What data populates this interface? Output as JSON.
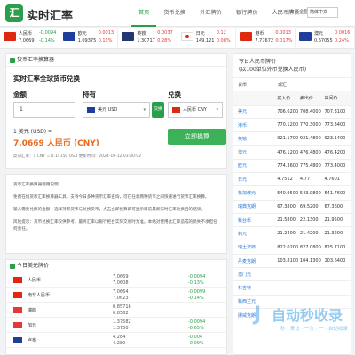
{
  "app": {
    "logo_char": "汇",
    "name": "实时汇率"
  },
  "nav": [
    {
      "label": "首页",
      "active": true
    },
    {
      "label": "货币兑换"
    },
    {
      "label": "外汇牌价"
    },
    {
      "label": "银行牌价"
    },
    {
      "label": "人民币牌价"
    },
    {
      "label": "货币代码"
    }
  ],
  "lang": {
    "label": "大写金额",
    "selected": "简体中文"
  },
  "ticker": [
    {
      "name": "人民币",
      "rate": "7.0669",
      "chg": "-0.0094",
      "pct": "-0.14%",
      "dir": "down",
      "flag": "#de2910"
    },
    {
      "name": "欧元",
      "rate": "1.09375",
      "chg": "0.0013",
      "pct": "0.12%",
      "dir": "up",
      "flag": "#1f3e9c"
    },
    {
      "name": "英镑",
      "rate": "1.30717",
      "chg": "0.0037",
      "pct": "0.28%",
      "dir": "up",
      "flag": "#23366f"
    },
    {
      "name": "日元",
      "rate": "149.121",
      "chg": "0.12",
      "pct": "0.08%",
      "dir": "up",
      "flag": "#ffffff"
    },
    {
      "name": "港币",
      "rate": "7.77672",
      "chg": "0.0013",
      "pct": "0.017%",
      "dir": "up",
      "flag": "#de2910"
    },
    {
      "name": "澳元",
      "rate": "0.67055",
      "chg": "0.0016",
      "pct": "0.24%",
      "dir": "up",
      "flag": "#1f3e9c"
    }
  ],
  "converter": {
    "panel_title": "货币汇率换算器",
    "title": "实时汇率全球货币兑换",
    "amount_label": "金额",
    "amount_value": "1",
    "from_label": "持有",
    "from_value": "美元 USD",
    "swap_label": "交换",
    "to_label": "兑换",
    "to_value": "人民币 CNY",
    "one_line": "1 美元 (USD) =",
    "result": "7.0669 人民币 (CNY)",
    "button": "立即换算",
    "note": "反向汇率：1 CNY = 0.14150 USD  更新时间：2024-10-12 03:30:02"
  },
  "description": {
    "title": "货币汇率换算器使用说明：",
    "p1": "免费在线货币汇率换算器工具，支持今日多种货币汇率查询，可在任意两种货币之间快速进行货币汇率换算。",
    "p2": "输入需要兑换的金额，选择持有货币与兑换货币，点击立即换算即可显示目前最新实时汇率兑换后的结果。",
    "p3": "风险提示：货币兑换汇率仅供参考，最终汇率以银行柜台实际交易时为准。本站对使用此汇率造成的损失不承担任何责任。"
  },
  "today_list": {
    "title": "今日美元牌价",
    "rows": [
      {
        "name": "人民币",
        "rate": "7.0669",
        "rate2": "7.0608",
        "chg": "-0.0094",
        "pct": "-0.13%",
        "dir": "down",
        "flag": "#de2910"
      },
      {
        "name": "南非人民币",
        "rate": "7.0664",
        "rate2": "7.0623",
        "chg": "-0.0099",
        "pct": "-0.14%",
        "dir": "down",
        "flag": "#de2910"
      },
      {
        "name": "瑞郎",
        "rate": "0.85716",
        "rate2": "0.8562",
        "chg": "",
        "pct": "",
        "dir": "down",
        "flag": "#e23a3a"
      },
      {
        "name": "加元",
        "rate": "1.37582",
        "rate2": "1.3750",
        "chg": "-0.0094",
        "pct": "-0.65%",
        "dir": "down",
        "flag": "#e23a3a"
      },
      {
        "name": "卢布",
        "rate": "4.284",
        "rate2": "4.280",
        "chg": "-0.004",
        "pct": "-0.09%",
        "dir": "down",
        "flag": "#1f3e9c"
      }
    ]
  },
  "rmb_panel": {
    "title": "今日人民币牌价",
    "subtitle": "(以100单位外币兑换人民币)",
    "header": [
      "货币",
      "现汇",
      "",
      ""
    ],
    "subheader": [
      "",
      "买入价",
      "卖出价",
      "中间价"
    ],
    "rows": [
      [
        "美元",
        "706.6200",
        "708.4000",
        "707.3100"
      ],
      [
        "港币",
        "770.1200",
        "770.3000",
        "773.3400"
      ],
      [
        "英镑",
        "921.1700",
        "921.4800",
        "923.1400"
      ],
      [
        "澳元",
        "476.1200",
        "476.4800",
        "476.4200"
      ],
      [
        "欧元",
        "774.3600",
        "775.4800",
        "773.4000"
      ],
      [
        "日元",
        "4.7512",
        "4.77",
        "4.7601"
      ],
      [
        "新加坡元",
        "540.9500",
        "543.9800",
        "541.7600"
      ],
      [
        "瑞典克朗",
        "67.3800",
        "69.5200",
        "67.3600"
      ],
      [
        "新台币",
        "21.5800",
        "22.1300",
        "21.9500"
      ],
      [
        "韩元",
        "21.2400",
        "21.4200",
        "21.3200"
      ],
      [
        "瑞士法郎",
        "822.0200",
        "827.0800",
        "825.7100"
      ],
      [
        "丹麦克朗",
        "103.8100",
        "104.1300",
        "103.6400"
      ],
      [
        "澳门元",
        "",
        "",
        ""
      ],
      [
        "林吉特",
        "",
        "",
        ""
      ],
      [
        "新西兰元",
        "",
        "",
        ""
      ],
      [
        "挪威克朗",
        "",
        "",
        ""
      ]
    ]
  },
  "watermark": {
    "big": "自动秒收录",
    "small": "秒 · 来访 · 一次 · 一 · 自动收录"
  }
}
